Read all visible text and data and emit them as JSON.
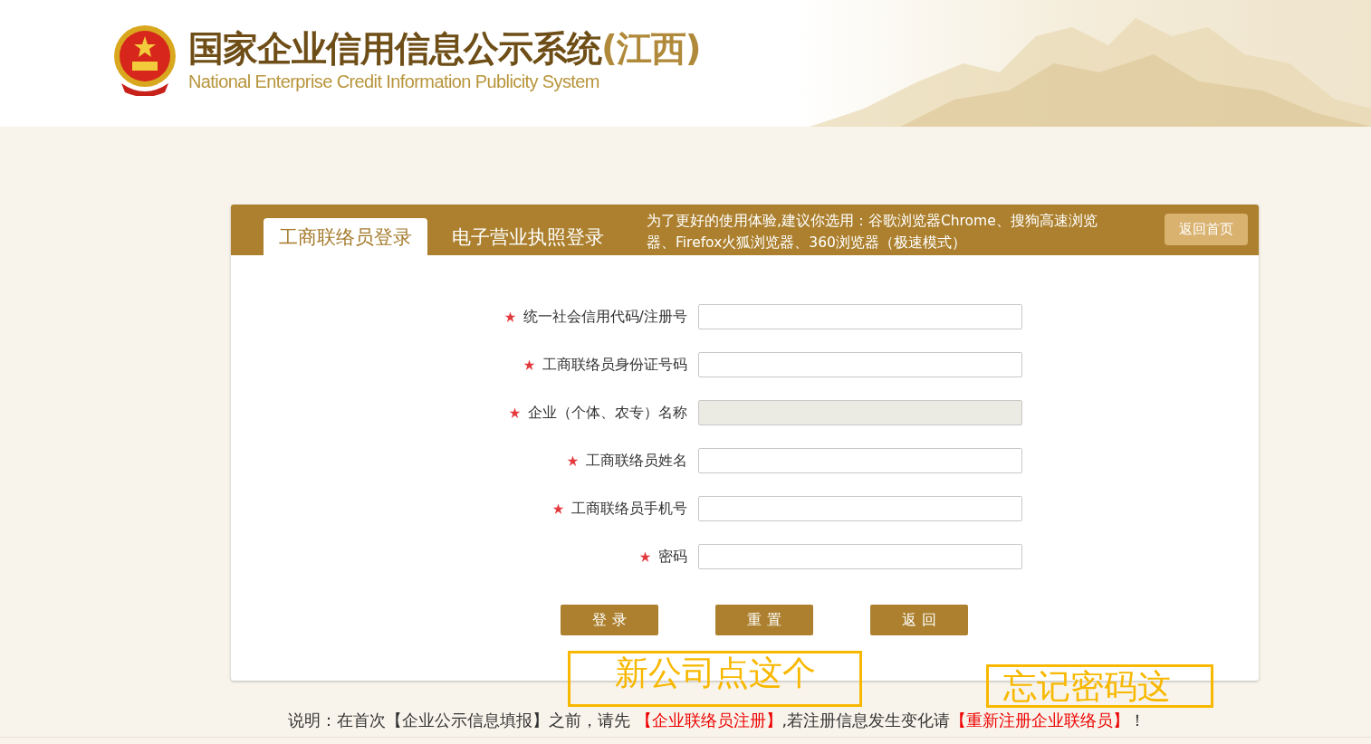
{
  "header": {
    "title_cn": "国家企业信用信息公示系统",
    "region": "(江西)",
    "title_en": "National Enterprise Credit Information Publicity System"
  },
  "tabs": [
    {
      "label": "工商联络员登录",
      "selected": true
    },
    {
      "label": "电子营业执照登录",
      "selected": false
    }
  ],
  "browser_notice": "为了更好的使用体验,建议你选用：谷歌浏览器Chrome、搜狗高速浏览器、Firefox火狐浏览器、360浏览器（极速模式）",
  "home_button": "返回首页",
  "form": {
    "fields": [
      {
        "label": "统一社会信用代码/注册号",
        "required": true,
        "disabled": false
      },
      {
        "label": "工商联络员身份证号码",
        "required": true,
        "disabled": false
      },
      {
        "label": "企业（个体、农专）名称",
        "required": true,
        "disabled": true
      },
      {
        "label": "工商联络员姓名",
        "required": true,
        "disabled": false
      },
      {
        "label": "工商联络员手机号",
        "required": true,
        "disabled": false
      },
      {
        "label": "密码",
        "required": true,
        "disabled": false
      }
    ],
    "buttons": [
      "登 录",
      "重 置",
      "返 回"
    ]
  },
  "note": [
    {
      "kind": "plain",
      "text": "说明：在首次【企业公示信息填报】之前，请先 "
    },
    {
      "kind": "link",
      "text": "【企业联络员注册】"
    },
    {
      "kind": "plain",
      "text": ",若注册信息发生变化请"
    },
    {
      "kind": "link",
      "text": "【重新注册企业联络员】"
    },
    {
      "kind": "plain",
      "text": "！"
    }
  ],
  "annotations": [
    {
      "text": "新公司点这个"
    },
    {
      "text": "忘记密码这"
    }
  ]
}
